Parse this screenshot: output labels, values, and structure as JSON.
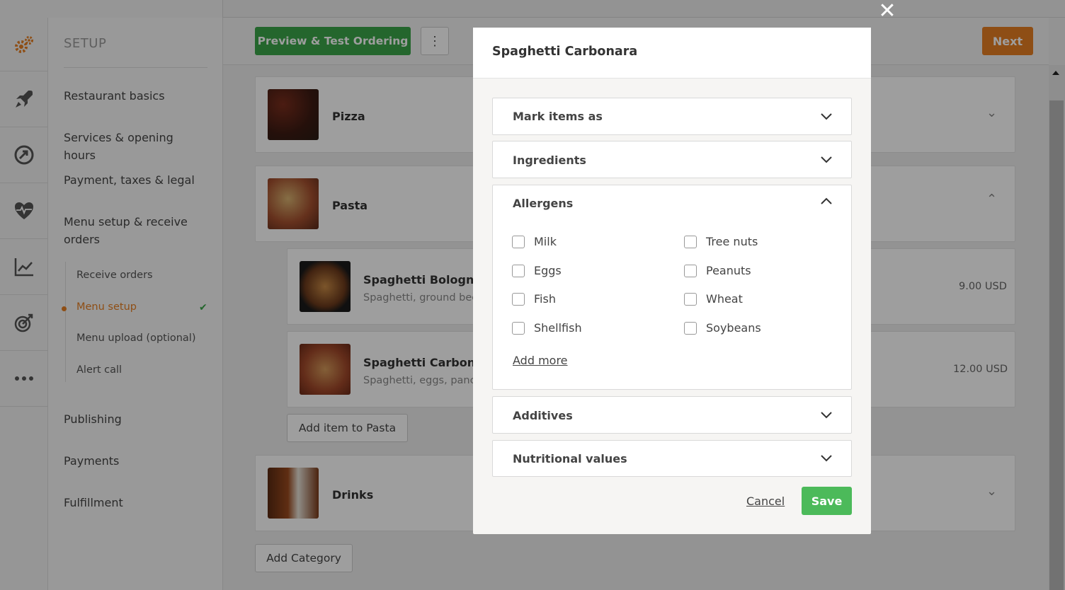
{
  "setup": {
    "title": "SETUP",
    "nav": [
      {
        "label": "Restaurant basics"
      },
      {
        "label": "Services & opening hours"
      },
      {
        "label": "Payment, taxes & legal"
      },
      {
        "label": "Menu setup & receive orders"
      },
      {
        "label": "Publishing"
      },
      {
        "label": "Payments"
      },
      {
        "label": "Fulfillment"
      }
    ],
    "sub_items": [
      {
        "label": "Receive orders"
      },
      {
        "label": "Menu setup",
        "active": true
      },
      {
        "label": "Menu upload (optional)"
      },
      {
        "label": "Alert call"
      }
    ],
    "check": "✔"
  },
  "rail_icons": [
    "gears-icon",
    "rocket-icon",
    "growth-arrow-icon",
    "heart-pulse-icon",
    "line-chart-icon",
    "target-icon",
    "more-dots-icon"
  ],
  "toolbar": {
    "preview_label": "Preview & Test Ordering",
    "more_label": "⋮",
    "next_label": "Next"
  },
  "menu": {
    "categories": [
      {
        "name": "Pizza"
      },
      {
        "name": "Pasta"
      },
      {
        "name": "Drinks"
      }
    ],
    "pasta_items": [
      {
        "title": "Spaghetti Bolognese",
        "desc": "Spaghetti, ground beef",
        "price": "9.00 USD"
      },
      {
        "title": "Spaghetti Carbonara",
        "desc": "Spaghetti, eggs, pancet",
        "price": "12.00 USD"
      }
    ],
    "add_item_label": "Add item to Pasta",
    "add_category_label": "Add Category"
  },
  "modal": {
    "title": "Spaghetti Carbonara",
    "sections": {
      "mark_items": "Mark items as",
      "ingredients": "Ingredients",
      "allergens": "Allergens",
      "additives": "Additives",
      "nutritional": "Nutritional values"
    },
    "allergens": {
      "left": [
        "Milk",
        "Eggs",
        "Fish",
        "Shellfish"
      ],
      "right": [
        "Tree nuts",
        "Peanuts",
        "Wheat",
        "Soybeans"
      ]
    },
    "add_more": "Add more",
    "cancel": "Cancel",
    "save": "Save",
    "close": "✕"
  },
  "colors": {
    "brand_green": "#3aa54a",
    "accent_orange": "#e67e22",
    "save_green": "#4cba5a"
  }
}
